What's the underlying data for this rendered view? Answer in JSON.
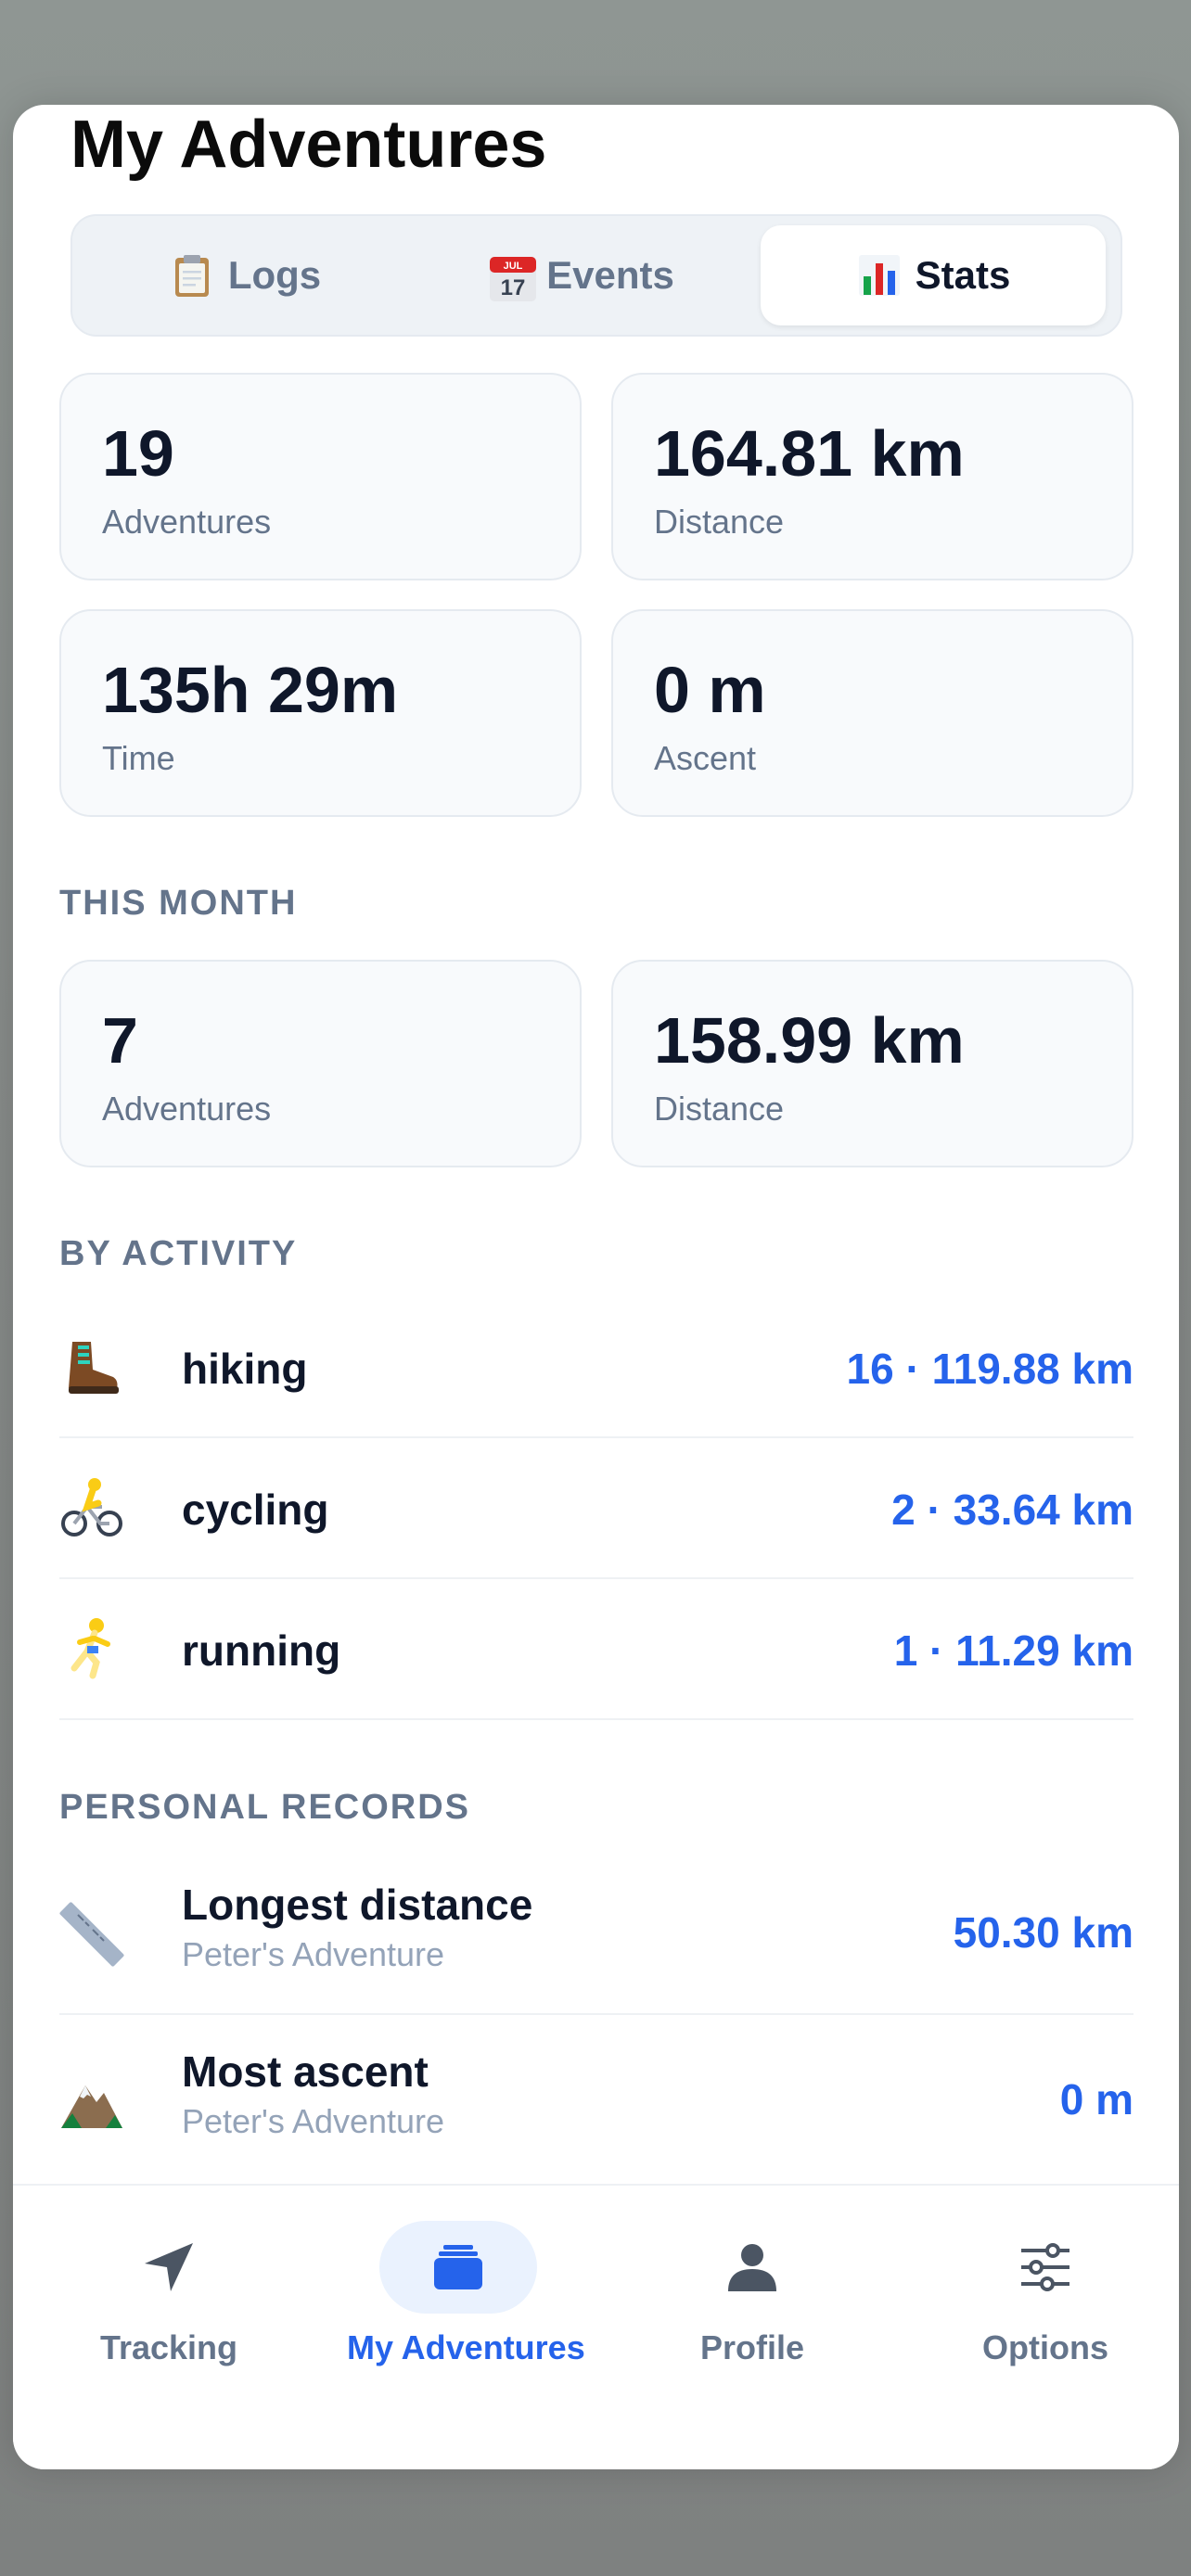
{
  "header": {
    "title": "My Adventures"
  },
  "segments": [
    {
      "label": "Logs",
      "icon": "clipboard-icon"
    },
    {
      "label": "Events",
      "icon": "calendar-icon",
      "icon_text_top": "JUL",
      "icon_text_day": "17"
    },
    {
      "label": "Stats",
      "icon": "bar-chart-icon",
      "active": true
    }
  ],
  "totals": {
    "adventures": {
      "value": "19",
      "label": "Adventures"
    },
    "distance": {
      "value": "164.81 km",
      "label": "Distance"
    },
    "time": {
      "value": "135h 29m",
      "label": "Time"
    },
    "ascent": {
      "value": "0 m",
      "label": "Ascent"
    }
  },
  "this_month": {
    "heading": "THIS MONTH",
    "adventures": {
      "value": "7",
      "label": "Adventures"
    },
    "distance": {
      "value": "158.99 km",
      "label": "Distance"
    }
  },
  "by_activity": {
    "heading": "BY ACTIVITY",
    "items": [
      {
        "name": "hiking",
        "summary": "16 · 119.88 km",
        "icon": "hiking-boot-icon"
      },
      {
        "name": "cycling",
        "summary": "2 · 33.64 km",
        "icon": "cyclist-icon"
      },
      {
        "name": "running",
        "summary": "1 · 11.29 km",
        "icon": "runner-icon"
      }
    ]
  },
  "records": {
    "heading": "PERSONAL RECORDS",
    "items": [
      {
        "title": "Longest distance",
        "subtitle": "Peter's Adventure",
        "value": "50.30 km",
        "icon": "ruler-icon"
      },
      {
        "title": "Most ascent",
        "subtitle": "Peter's Adventure",
        "value": "0 m",
        "icon": "mountain-icon"
      }
    ]
  },
  "tabbar": {
    "items": [
      {
        "label": "Tracking",
        "icon": "navigation-arrow-icon"
      },
      {
        "label": "My Adventures",
        "icon": "stack-icon",
        "active": true
      },
      {
        "label": "Profile",
        "icon": "person-icon"
      },
      {
        "label": "Options",
        "icon": "sliders-icon"
      }
    ]
  },
  "colors": {
    "accent": "#2563eb",
    "muted": "#64748b",
    "card_bg": "#f8fafc"
  }
}
